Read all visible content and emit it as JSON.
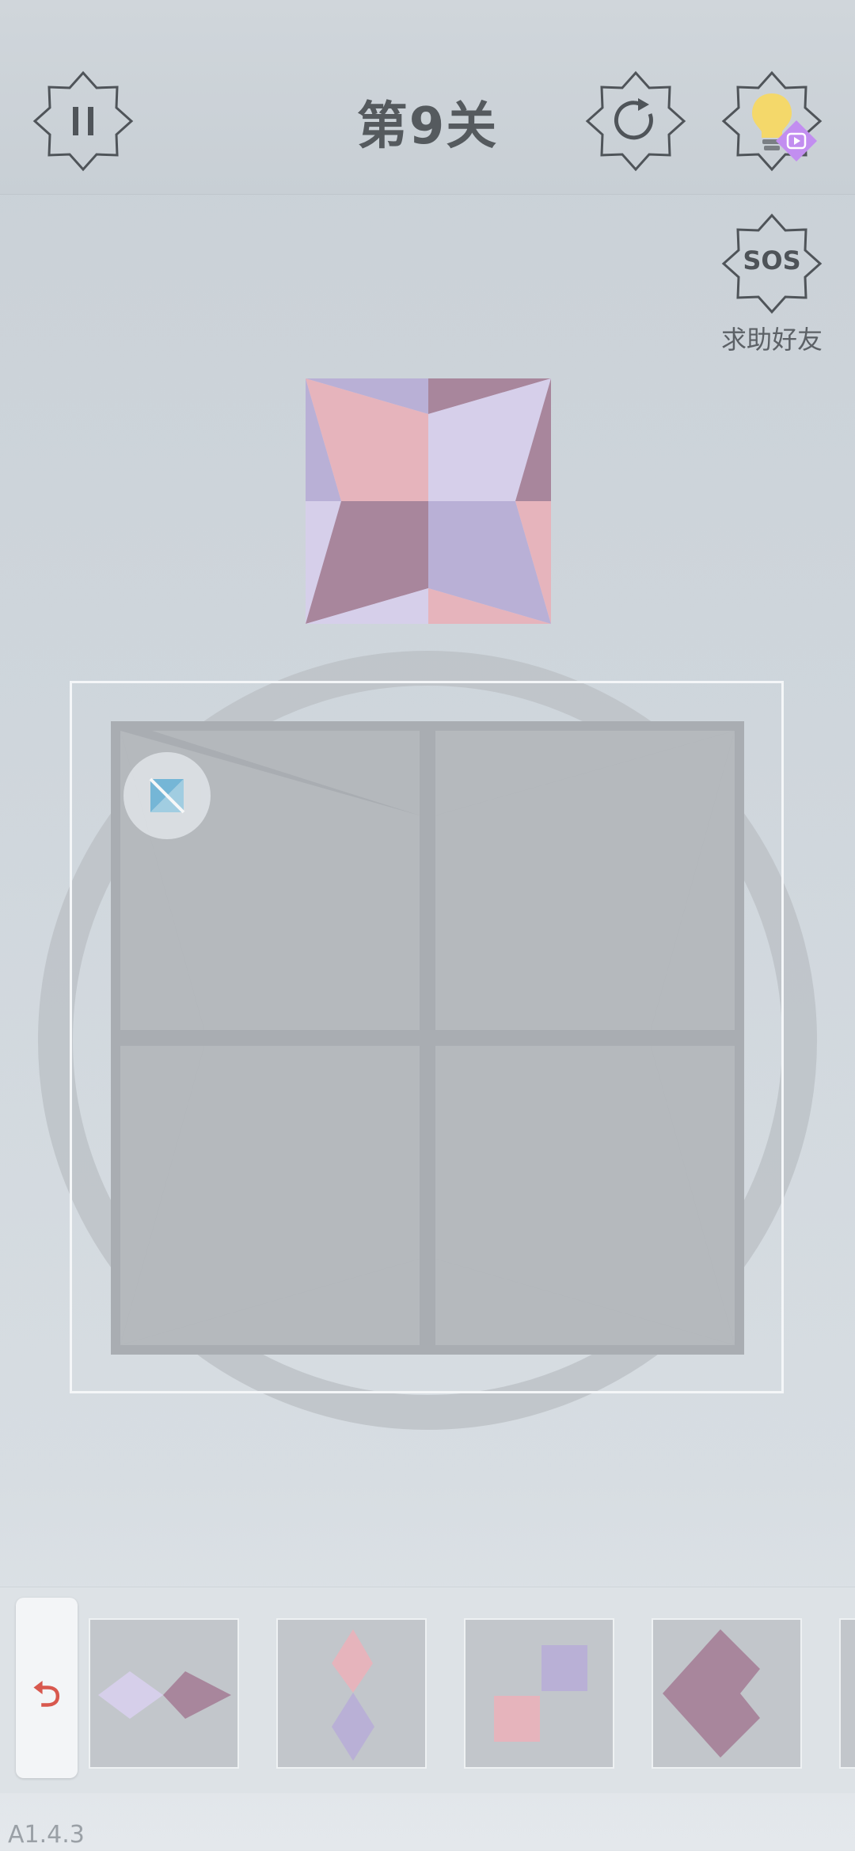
{
  "header": {
    "title": "第9关",
    "pause_icon": "pause-icon",
    "restart_icon": "restart-icon",
    "hint_icon": "lightbulb-icon",
    "ad_badge_icon": "video-ad-icon"
  },
  "sos": {
    "icon_text": "SOS",
    "label": "求助好友"
  },
  "target_pattern": {
    "colors": {
      "pink": "#e6b4bc",
      "lavender": "#d6cfea",
      "purple": "#b9b0d6",
      "mauve": "#a8869c"
    }
  },
  "board": {
    "rotate_badge_icon": "rotate-piece-icon"
  },
  "tray": {
    "undo_icon": "undo-icon",
    "undo_symbol": "⮌",
    "pieces": [
      {
        "name": "piece-two-diamonds-horizontal"
      },
      {
        "name": "piece-two-diamonds-vertical"
      },
      {
        "name": "piece-two-squares-diagonal"
      },
      {
        "name": "piece-chevron"
      }
    ]
  },
  "version": "A1.4.3"
}
